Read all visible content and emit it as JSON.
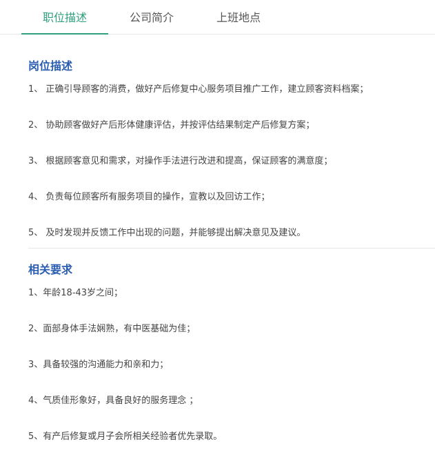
{
  "tabs": [
    {
      "label": "职位描述",
      "active": true
    },
    {
      "label": "公司简介",
      "active": false
    },
    {
      "label": "上班地点",
      "active": false
    }
  ],
  "accent_color": "#2e9e7c",
  "title_color": "#2a5db0",
  "duties": {
    "title": "岗位描述",
    "items": [
      "1、  正确引导顾客的消费，做好产后修复中心服务项目推广工作，建立顾客资料档案；",
      "2、  协助顾客做好产后形体健康评估，并按评估结果制定产后修复方案；",
      "3、  根据顾客意见和需求，对操作手法进行改进和提高，保证顾客的满意度；",
      "4、  负责每位顾客所有服务项目的操作，宣教以及回访工作；",
      "5、  及时发现并反馈工作中出现的问题，并能够提出解决意见及建议。"
    ]
  },
  "requirements": {
    "title": "相关要求",
    "items": [
      "1、年龄18-43岁之间；",
      "2、面部身体手法娴熟，有中医基础为佳；",
      "3、具备较强的沟通能力和亲和力；",
      "4、气质佳形象好，具备良好的服务理念 ；",
      "5、有产后修复或月子会所相关经验者优先录取。"
    ]
  }
}
